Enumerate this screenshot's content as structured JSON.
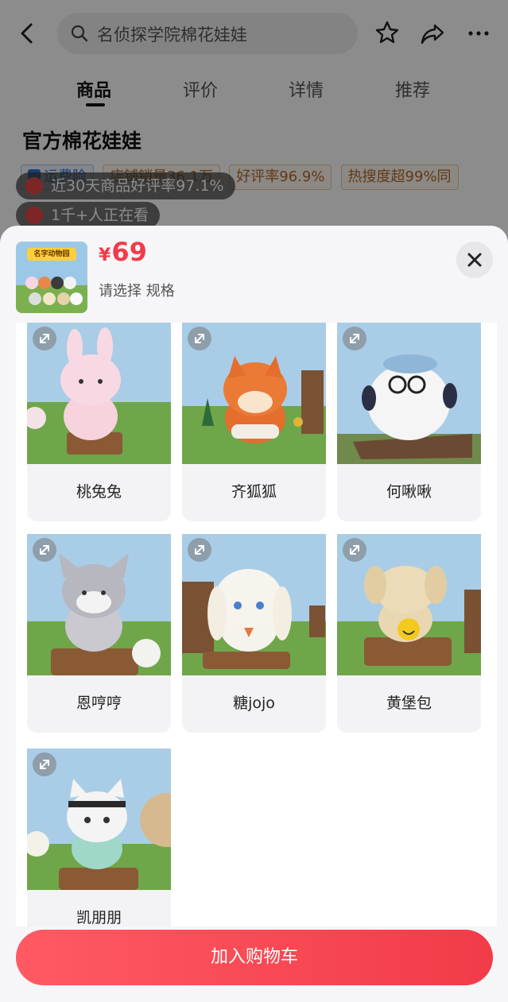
{
  "header": {
    "search_text": "名侦探学院棉花娃娃"
  },
  "tabs": [
    "商品",
    "评价",
    "详情",
    "推荐"
  ],
  "product": {
    "title": "官方棉花娃娃",
    "badges": [
      "运费险",
      "店铺销量36.1万",
      "好评率96.9%",
      "热搜度超99%同"
    ]
  },
  "floating_notes": [
    "近30天商品好评率97.1%",
    "1千+人正在看"
  ],
  "sheet": {
    "price_symbol": "¥",
    "price_value": "69",
    "spec_hint": "请选择 规格",
    "thumb_banner": "名字动物园",
    "options": [
      "桃兔兔",
      "齐狐狐",
      "何啾啾",
      "恩哼哼",
      "糖jojo",
      "黄堡包",
      "凯朋朋"
    ],
    "add_to_cart": "加入购物车"
  },
  "colors": {
    "accent": "#f23b48",
    "badge_text": "#b06a2a",
    "badge_blue": "#2e6fd1"
  },
  "icons": [
    "back-icon",
    "search-icon",
    "star-icon",
    "share-icon",
    "more-icon",
    "close-icon",
    "expand-icon",
    "shield-icon"
  ]
}
